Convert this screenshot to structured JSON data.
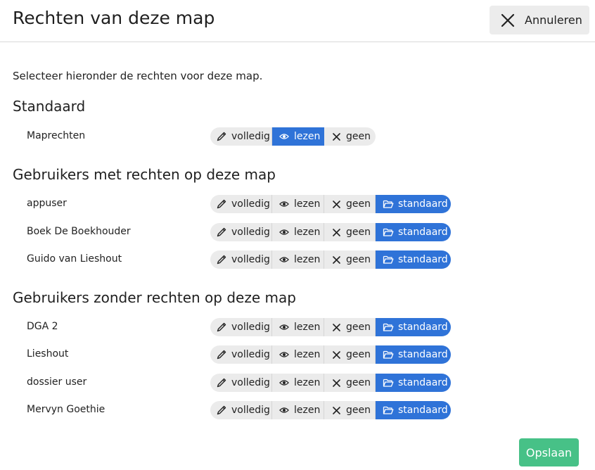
{
  "dialog": {
    "title": "Rechten van deze map",
    "cancel_label": "Annuleren",
    "intro": "Selecteer hieronder de rechten voor deze map.",
    "save_label": "Opslaan"
  },
  "options": {
    "full": "volledig",
    "read": "lezen",
    "none": "geen",
    "standard": "standaard"
  },
  "sections": {
    "standard": {
      "title": "Standaard",
      "rows": [
        {
          "label": "Maprechten",
          "selected": "read"
        }
      ]
    },
    "with_rights": {
      "title": "Gebruikers met rechten op deze map",
      "rows": [
        {
          "label": "appuser",
          "selected": "standard"
        },
        {
          "label": "Boek De Boekhouder",
          "selected": "standard"
        },
        {
          "label": "Guido van Lieshout",
          "selected": "standard"
        }
      ]
    },
    "without_rights": {
      "title": "Gebruikers zonder rechten op deze map",
      "rows": [
        {
          "label": "DGA 2",
          "selected": "standard"
        },
        {
          "label": "Lieshout",
          "selected": "standard"
        },
        {
          "label": "dossier user",
          "selected": "standard"
        },
        {
          "label": "Mervyn Goethie",
          "selected": "standard"
        }
      ]
    }
  },
  "colors": {
    "active": "#2f73d8",
    "inactive": "#ebebeb",
    "save": "#47c187",
    "cancel_bg": "#ececec"
  },
  "icons": {
    "full": "pencil-icon",
    "read": "eye-icon",
    "none": "x-icon",
    "standard": "folder-open-icon",
    "cancel": "close-icon"
  }
}
